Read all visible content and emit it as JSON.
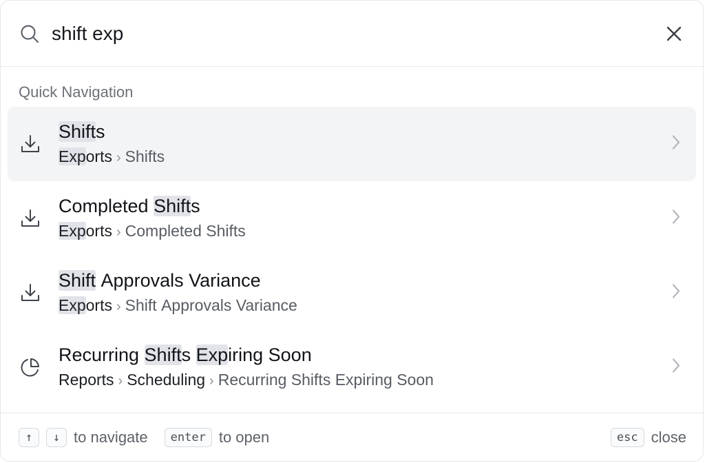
{
  "search": {
    "query": "shift exp",
    "placeholder": ""
  },
  "section_label": "Quick Navigation",
  "results": [
    {
      "title_parts": [
        {
          "t": "Shift",
          "hl": true
        },
        {
          "t": "s",
          "hl": false
        }
      ],
      "path_parts": [
        [
          {
            "t": "Exp",
            "hl": true
          },
          {
            "t": "orts",
            "hl": false
          }
        ],
        [
          {
            "t": "Shifts",
            "hl": false
          }
        ]
      ],
      "icon": "download-icon"
    },
    {
      "title_parts": [
        {
          "t": "Completed ",
          "hl": false
        },
        {
          "t": "Shift",
          "hl": true
        },
        {
          "t": "s",
          "hl": false
        }
      ],
      "path_parts": [
        [
          {
            "t": "Exp",
            "hl": true
          },
          {
            "t": "orts",
            "hl": false
          }
        ],
        [
          {
            "t": "Completed Shifts",
            "hl": false
          }
        ]
      ],
      "icon": "download-icon"
    },
    {
      "title_parts": [
        {
          "t": "Shift",
          "hl": true
        },
        {
          "t": " Approvals Variance",
          "hl": false
        }
      ],
      "path_parts": [
        [
          {
            "t": "Exp",
            "hl": true
          },
          {
            "t": "orts",
            "hl": false
          }
        ],
        [
          {
            "t": "Shift Approvals Variance",
            "hl": false
          }
        ]
      ],
      "icon": "download-icon"
    },
    {
      "title_parts": [
        {
          "t": "Recurring ",
          "hl": false
        },
        {
          "t": "Shift",
          "hl": true
        },
        {
          "t": "s ",
          "hl": false
        },
        {
          "t": "Exp",
          "hl": true
        },
        {
          "t": "iring Soon",
          "hl": false
        }
      ],
      "path_parts": [
        [
          {
            "t": "Reports",
            "hl": false
          }
        ],
        [
          {
            "t": "Scheduling",
            "hl": false
          }
        ],
        [
          {
            "t": "Recurring Shifts Expiring Soon",
            "hl": false
          }
        ]
      ],
      "icon": "pie-chart-icon"
    }
  ],
  "footer": {
    "up_key": "↑",
    "down_key": "↓",
    "navigate_label": "to navigate",
    "enter_key": "enter",
    "open_label": "to open",
    "esc_key": "esc",
    "close_label": "close"
  },
  "colors": {
    "highlight": "#e1e3e8",
    "active_row": "#f3f4f6",
    "muted_text": "#575c63"
  }
}
